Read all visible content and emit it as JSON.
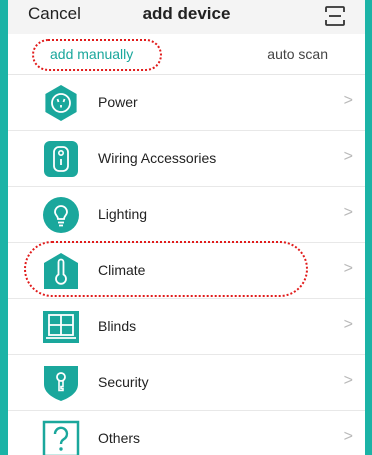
{
  "header": {
    "cancel": "Cancel",
    "title": "add device",
    "scan_icon": "scan-icon"
  },
  "tabs": {
    "manual": "add manually",
    "auto": "auto scan"
  },
  "items": [
    {
      "label": "Power",
      "chevron": ">",
      "icon": "power-socket-icon"
    },
    {
      "label": "Wiring Accessories",
      "chevron": ">",
      "icon": "wall-switch-icon"
    },
    {
      "label": "Lighting",
      "chevron": ">",
      "icon": "light-bulb-icon"
    },
    {
      "label": "Climate",
      "chevron": ">",
      "icon": "thermometer-icon"
    },
    {
      "label": "Blinds",
      "chevron": ">",
      "icon": "window-blinds-icon"
    },
    {
      "label": "Security",
      "chevron": ">",
      "icon": "security-shield-icon"
    },
    {
      "label": "Others",
      "chevron": ">",
      "icon": "question-icon"
    }
  ],
  "colors": {
    "accent": "#1aa79c",
    "highlight": "#e11c1c",
    "frame": "#1bb3a6"
  }
}
